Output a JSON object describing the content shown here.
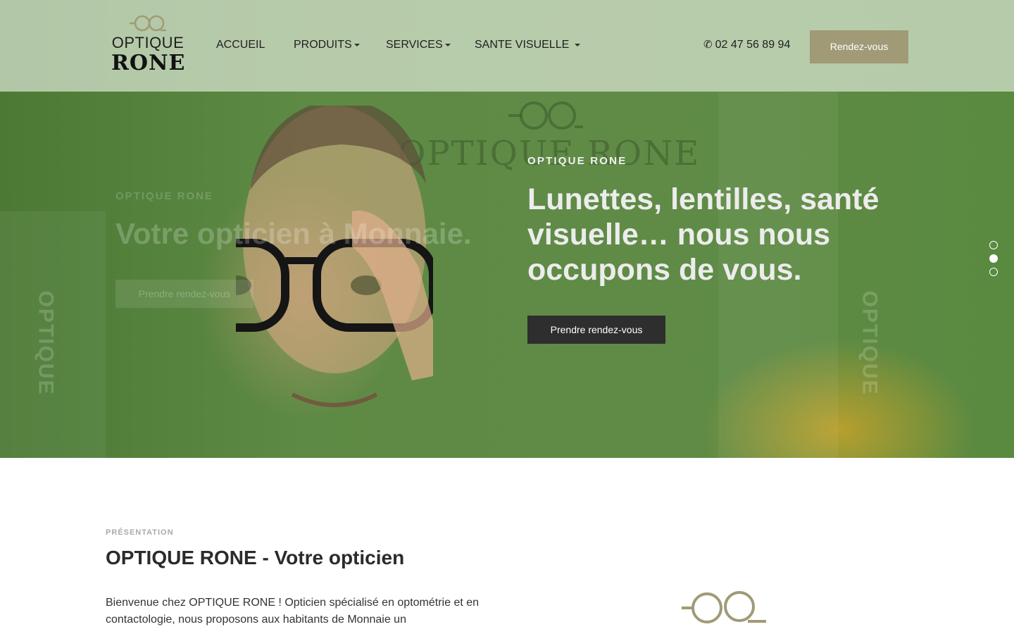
{
  "header": {
    "logo": {
      "line1": "OPTIQUE",
      "line2": "RONE"
    },
    "nav": [
      {
        "label": "ACCUEIL",
        "dropdown": false
      },
      {
        "label": "PRODUITS",
        "dropdown": true
      },
      {
        "label": "SERVICES",
        "dropdown": true
      },
      {
        "label": "SANTE VISUELLE",
        "dropdown": true
      }
    ],
    "phone": "02 47 56 89 94",
    "cta_label": "Rendez-vous"
  },
  "hero": {
    "previous_slide": {
      "eyebrow": "OPTIQUE RONE",
      "title": "Votre opticien à Monnaie.",
      "button": "Prendre rendez-vous"
    },
    "active_slide": {
      "eyebrow": "OPTIQUE RONE",
      "title": "Lunettes, lentilles, santé visuelle… nous nous occupons de vous.",
      "button": "Prendre rendez-vous"
    },
    "background_sign": "OPTIQUE RONE",
    "side_text": "OPTIQUE",
    "slider": {
      "count": 3,
      "active_index": 1
    }
  },
  "presentation": {
    "eyebrow": "PRÉSENTATION",
    "title": "OPTIQUE RONE - Votre opticien",
    "text": "Bienvenue chez OPTIQUE RONE ! Opticien spécialisé en optométrie et en contactologie, nous proposons aux habitants de Monnaie un"
  },
  "colors": {
    "header_bg": "#dae4d2",
    "cta_bg": "#a09a77",
    "hero_green": "#5d8a44",
    "dark_button": "#2e2e2e",
    "logo_ring": "#a09a77"
  }
}
